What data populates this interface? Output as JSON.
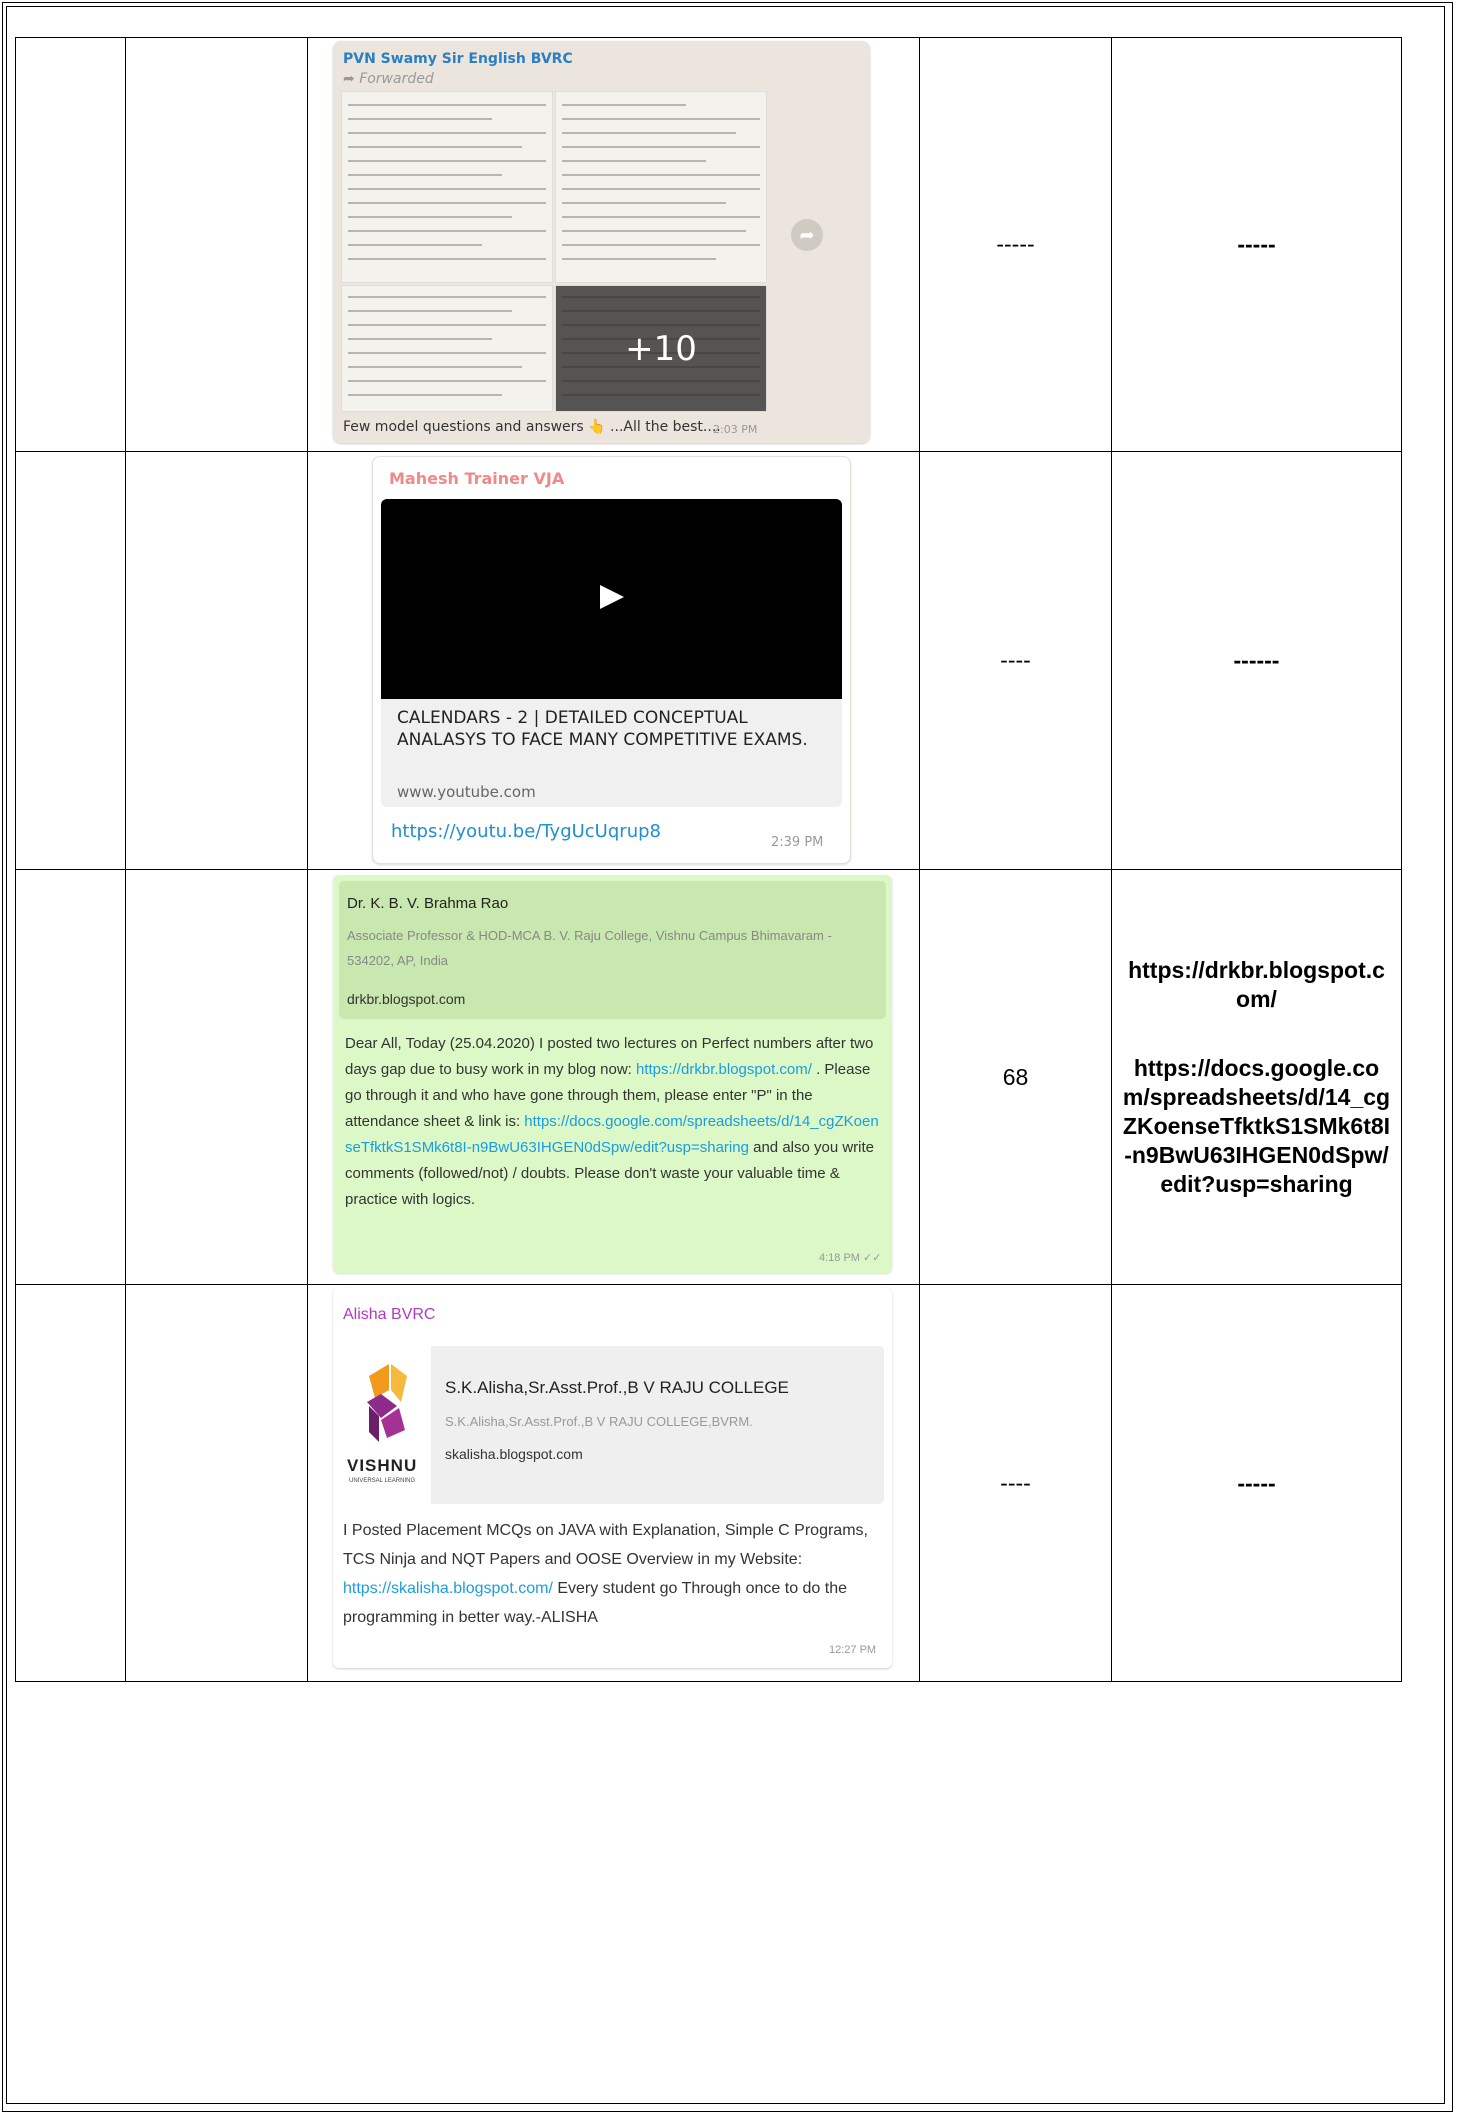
{
  "rows": [
    {
      "sender": "PVN Swamy Sir English BVRC",
      "forwarded": "Forwarded",
      "more_count": "+10",
      "caption": "Few model questions and answers 👆 ...All the best....",
      "time": "2:03 PM",
      "count": "-----",
      "links": "-----"
    },
    {
      "sender": "Mahesh Trainer VJA",
      "video_title": "CALENDARS - 2 | DETAILED CONCEPTUAL ANALASYS TO FACE MANY COMPETITIVE EXAMS.",
      "video_site": "www.youtube.com",
      "link": "https://youtu.be/TygUcUqrup8",
      "time": "2:39 PM",
      "count": "----",
      "links": "------"
    },
    {
      "preview_name": "Dr. K. B. V. Brahma Rao",
      "preview_desc": "Associate Professor & HOD-MCA B. V. Raju College, Vishnu Campus Bhimavaram - 534202, AP, India",
      "preview_site": "drkbr.blogspot.com",
      "msg_part1": "Dear All, Today (25.04.2020) I posted two lectures on Perfect numbers after two days gap due to busy work in my blog now: ",
      "msg_link1": "https://drkbr.blogspot.com/",
      "msg_part2": " . Please go through it and who have gone through them, please enter \"P\" in the attendance sheet & link is: ",
      "msg_link2": "https://docs.google.com/spreadsheets/d/14_cgZKoenseTfktkS1SMk6t8I-n9BwU63IHGEN0dSpw/edit?usp=sharing",
      "msg_part3": " and also you write comments (followed/not) / doubts. Please don't waste your valuable time & practice with logics.",
      "time": "4:18 PM",
      "count": "68",
      "link_a": "https://drkbr.blogspot.com/",
      "link_b": "https://docs.google.com/spreadsheets/d/14_cgZKoenseTfktkS1SMk6t8I-n9BwU63IHGEN0dSpw/edit?usp=sharing"
    },
    {
      "sender": "Alisha BVRC",
      "preview_name": "S.K.Alisha,Sr.Asst.Prof.,B V RAJU COLLEGE",
      "preview_desc": "S.K.Alisha,Sr.Asst.Prof.,B V RAJU COLLEGE,BVRM.",
      "preview_site": "skalisha.blogspot.com",
      "logo_text": "VISHNU",
      "logo_sub": "UNIVERSAL LEARNING",
      "msg_part1": "I Posted Placement MCQs on JAVA with Explanation, Simple C Programs, TCS Ninja and NQT Papers and OOSE Overview in my Website: ",
      "msg_link": "https://skalisha.blogspot.com/",
      "msg_part2": " Every student go Through once to do the programming in better way.-ALISHA",
      "time": "12:27 PM",
      "count": "----",
      "links": "-----"
    }
  ]
}
